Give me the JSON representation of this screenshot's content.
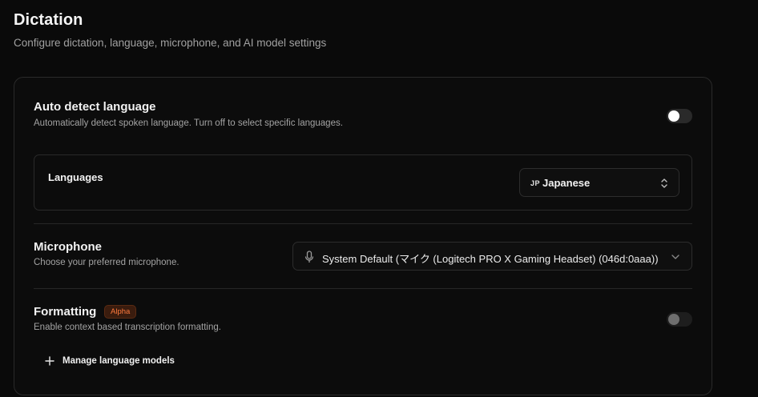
{
  "page": {
    "title": "Dictation",
    "subtitle": "Configure dictation, language, microphone, and AI model settings"
  },
  "auto_detect": {
    "title": "Auto detect language",
    "description": "Automatically detect spoken language. Turn off to select specific languages.",
    "enabled": false
  },
  "languages": {
    "label": "Languages",
    "selected_code": "JP",
    "selected_name": "Japanese"
  },
  "microphone": {
    "title": "Microphone",
    "description": "Choose your preferred microphone.",
    "selected": "System Default (マイク (Logitech PRO X Gaming Headset) (046d:0aaa))"
  },
  "formatting": {
    "title": "Formatting",
    "badge": "Alpha",
    "description": "Enable context based transcription formatting.",
    "enabled": false,
    "disabled": true
  },
  "manage_models": {
    "label": "Manage language models"
  },
  "colors": {
    "background": "#0a0a0a",
    "card_border": "#2a2a2a",
    "badge_text": "#ff7a3d",
    "badge_bg": "#3a1c0e"
  },
  "icons": {
    "microphone": "microphone-icon",
    "select_updown": "chevron-up-down-icon",
    "select_down": "chevron-down-icon",
    "add": "plus-icon"
  }
}
